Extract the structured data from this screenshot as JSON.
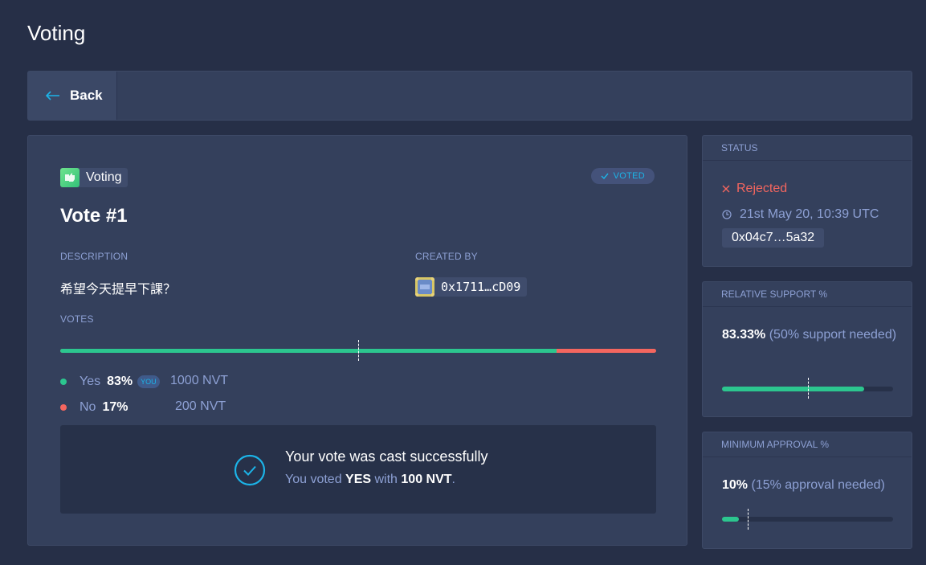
{
  "page_title": "Voting",
  "topbar": {
    "back_label": "Back"
  },
  "vote": {
    "app_name": "Voting",
    "voted_tag": "VOTED",
    "title": "Vote #1",
    "description_label": "DESCRIPTION",
    "description": "希望今天提早下課？",
    "created_by_label": "CREATED BY",
    "creator_address": "0x1711…cD09",
    "votes_label": "VOTES",
    "yes": {
      "label": "Yes",
      "pct": "83%",
      "pct_value": 0.8333,
      "you_tag": "YOU",
      "stake": "1000 NVT"
    },
    "no": {
      "label": "No",
      "pct": "17%",
      "stake": "200 NVT"
    },
    "support_marker": 0.5
  },
  "success": {
    "title": "Your vote was cast successfully",
    "sub_prefix": "You voted ",
    "choice": "YES",
    "sub_mid": " with ",
    "amount": "100 NVT",
    "sub_suffix": "."
  },
  "status": {
    "header": "STATUS",
    "state": "Rejected",
    "time": "21st May 20, 10:39 UTC",
    "tx_hash": "0x04c7…5a32"
  },
  "relative_support": {
    "header": "RELATIVE SUPPORT %",
    "value": "83.33%",
    "note": "(50% support needed)",
    "fill": 0.8333,
    "marker": 0.5
  },
  "minimum_approval": {
    "header": "MINIMUM APPROVAL %",
    "value": "10%",
    "note": "(15% approval needed)",
    "fill": 0.1,
    "marker": 0.15
  },
  "colors": {
    "background": "#262f47",
    "card": "#34405c",
    "yes": "#2cc68f",
    "no": "#f4665f",
    "accent": "#1cb4e8",
    "muted": "#8da0d4"
  }
}
